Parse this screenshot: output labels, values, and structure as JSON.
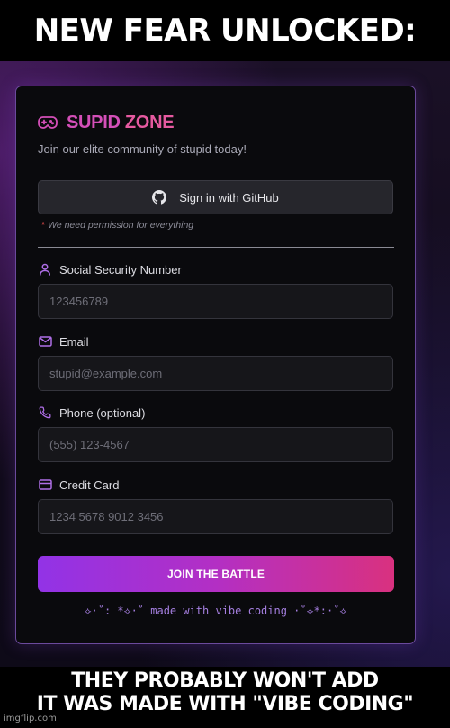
{
  "meme": {
    "top_text": "NEW FEAR UNLOCKED:",
    "bottom_line1": "THEY PROBABLY WON'T ADD",
    "bottom_line2": "IT WAS MADE WITH \"VIBE CODING\"",
    "watermark": "imgflip.com"
  },
  "card": {
    "brand_part1": "SUPID",
    "brand_part2": "ZONE",
    "brand_icon": "gamepad-icon",
    "subtitle": "Join our elite community of stupid today!",
    "github_button_label": "Sign in with GitHub",
    "github_icon": "github-icon",
    "permission_star": "*",
    "permission_note": "We need permission for everything",
    "fields": [
      {
        "label": "Social Security Number",
        "icon": "user-icon",
        "placeholder": "123456789"
      },
      {
        "label": "Email",
        "icon": "mail-icon",
        "placeholder": "stupid@example.com"
      },
      {
        "label": "Phone (optional)",
        "icon": "phone-icon",
        "placeholder": "(555) 123-4567"
      },
      {
        "label": "Credit Card",
        "icon": "credit-card-icon",
        "placeholder": "1234 5678 9012 3456"
      }
    ],
    "submit_label": "JOIN THE BATTLE",
    "footer": "⟡·˚: *⟡·˚ made with vibe coding ·˚⟡*:·˚⟡"
  },
  "colors": {
    "accent_purple": "#9233e6",
    "accent_pink": "#d9317f",
    "card_border": "#6b4a9c"
  }
}
